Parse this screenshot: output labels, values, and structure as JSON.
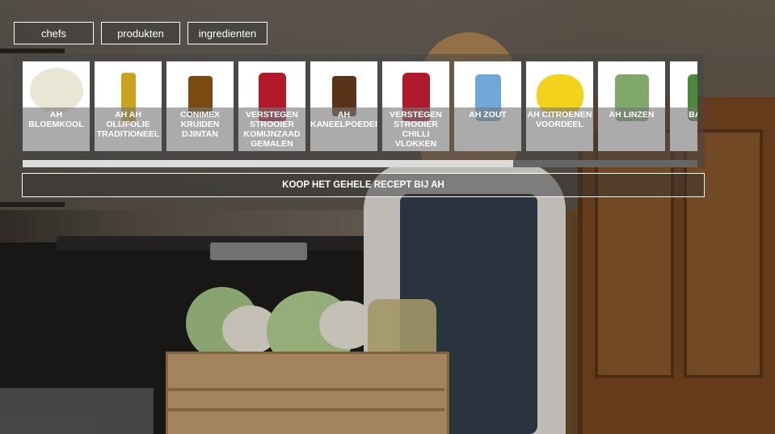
{
  "tabs": [
    {
      "label": "chefs"
    },
    {
      "label": "produkten"
    },
    {
      "label": "ingredienten"
    }
  ],
  "products": [
    {
      "name": "AH BLOEMKOOL",
      "icon": "cauliflower-icon",
      "color": "#e8e6d4"
    },
    {
      "name": "AH AH OLIJFOLIE TRADITIONEEL",
      "icon": "olive-oil-bottle-icon",
      "color": "#c9a21e"
    },
    {
      "name": "CONIMEX KRUIDEN DJINTAN",
      "icon": "spice-jar-icon",
      "color": "#7a4a12"
    },
    {
      "name": "VERSTEGEN STROOIER KOMIJNZAAD GEMALEN",
      "icon": "spice-shaker-icon",
      "color": "#b01a2a"
    },
    {
      "name": "AH KANEELPOEDER",
      "icon": "spice-jar-icon",
      "color": "#5a3418"
    },
    {
      "name": "VERSTEGEN STROOIER CHILLI VLOKKEN",
      "icon": "spice-shaker-icon",
      "color": "#b01a2a"
    },
    {
      "name": "AH ZOUT",
      "icon": "salt-container-icon",
      "color": "#6ea8d8"
    },
    {
      "name": "AH CITROENEN VOORDEEL",
      "icon": "lemon-bag-icon",
      "color": "#f2d21a"
    },
    {
      "name": "AH LINZEN",
      "icon": "can-icon",
      "color": "#7fa86a"
    },
    {
      "name": "BABYS",
      "icon": "spinach-bag-icon",
      "color": "#4a8a3a"
    }
  ],
  "scroll": {
    "fraction": 0.727
  },
  "cta": {
    "label": "KOOP HET GEHELE RECEPT BIJ AH"
  }
}
